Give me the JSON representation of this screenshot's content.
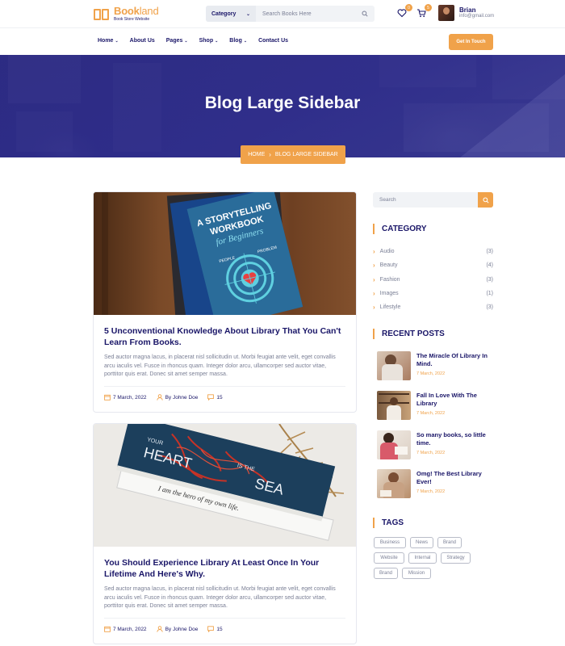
{
  "brand": {
    "name_main": "Book",
    "name_sub": "land",
    "tagline": "Book Store Website",
    "accent": "#f0a24a",
    "navy": "#1a1668"
  },
  "search": {
    "category_label": "Category",
    "placeholder": "Search Books Here"
  },
  "header": {
    "wishlist_count": "0",
    "cart_count": "5",
    "user_name": "Brian",
    "user_email": "info@gmail.com"
  },
  "nav": {
    "items": [
      {
        "label": "Home",
        "dropdown": true
      },
      {
        "label": "About Us",
        "dropdown": false
      },
      {
        "label": "Pages",
        "dropdown": true
      },
      {
        "label": "Shop",
        "dropdown": true
      },
      {
        "label": "Blog",
        "dropdown": true
      },
      {
        "label": "Contact Us",
        "dropdown": false
      }
    ],
    "cta": "Get In Touch"
  },
  "hero": {
    "title": "Blog Large Sidebar",
    "crumb_home": "HOME",
    "crumb_current": "BLOG LARGE SIDEBAR"
  },
  "posts": [
    {
      "title": "5 Unconventional Knowledge About Library That You Can't Learn From Books.",
      "excerpt": "Sed auctor magna lacus, in placerat nisl sollicitudin ut. Morbi feugiat ante velit, eget convallis arcu iaculis vel. Fusce in rhoncus quam. Integer dolor arcu, ullamcorper sed auctor vitae, porttitor quis erat. Donec sit amet semper massa.",
      "date": "7 March, 2022",
      "author": "By Johne Doe",
      "comments": "15",
      "image_text": {
        "line1": "A STORYTELLING",
        "line2": "WORKBOOK",
        "line3": "for Beginners",
        "left": "PEOPLE",
        "right": "PROBLEM"
      }
    },
    {
      "title": "You Should Experience Library At Least Once In Your Lifetime And Here's Why.",
      "excerpt": "Sed auctor magna lacus, in placerat nisl sollicitudin ut. Morbi feugiat ante velit, eget convallis arcu iaculis vel. Fusce in rhoncus quam. Integer dolor arcu, ullamcorper sed auctor vitae, porttitor quis erat. Donec sit amet semper massa.",
      "date": "7 March, 2022",
      "author": "By Johne Doe",
      "comments": "15",
      "image_text": {
        "w1": "YOUR",
        "w2": "HEART",
        "w3": "IS THE",
        "w4": "SEA",
        "script": "I am the hero of my own life."
      }
    }
  ],
  "sidebar": {
    "search_placeholder": "Search",
    "category_title": "CATEGORY",
    "categories": [
      {
        "name": "Audio",
        "count": "(3)"
      },
      {
        "name": "Beauty",
        "count": "(4)"
      },
      {
        "name": "Fashion",
        "count": "(3)"
      },
      {
        "name": "Images",
        "count": "(1)"
      },
      {
        "name": "Lifestyle",
        "count": "(3)"
      }
    ],
    "recent_title": "RECENT POSTS",
    "recent": [
      {
        "title": "The Miracle Of Library In Mind.",
        "date": "7 March, 2022"
      },
      {
        "title": "Fall In Love With The Library",
        "date": "7 March, 2022"
      },
      {
        "title": "So many books, so little time.",
        "date": "7 March, 2022"
      },
      {
        "title": "Omg! The Best Library Ever!",
        "date": "7 March, 2022"
      }
    ],
    "tags_title": "TAGS",
    "tags": [
      "Business",
      "News",
      "Brand",
      "Website",
      "Internal",
      "Strategy",
      "Brand",
      "Mission"
    ]
  }
}
